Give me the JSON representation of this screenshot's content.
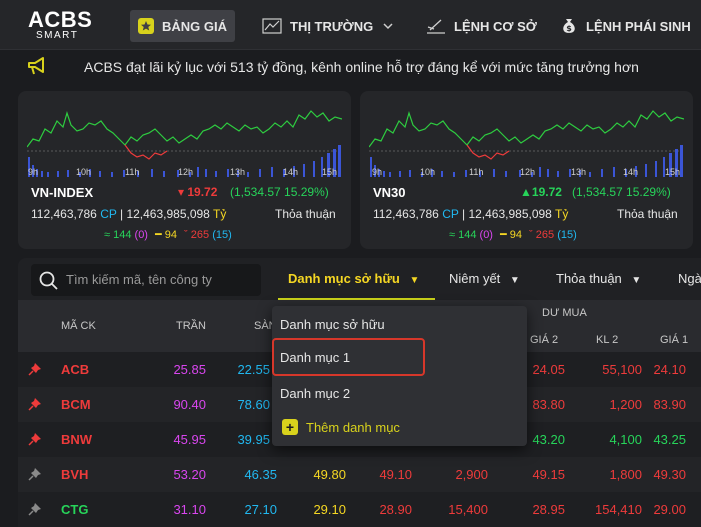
{
  "header": {
    "logo_main": "ACBS",
    "logo_sub": "SMART",
    "nav": [
      {
        "label": "BẢNG GIÁ",
        "icon": "star-icon",
        "active": true
      },
      {
        "label": "THỊ TRƯỜNG",
        "icon": "chart-icon"
      },
      {
        "label": "LỆNH CƠ SỞ",
        "icon": "pen-icon"
      },
      {
        "label": "LỆNH PHÁI SINH",
        "icon": "moneybag-icon"
      }
    ]
  },
  "ticker": {
    "text": "ACBS đạt lãi kỷ lục với 513 tỷ đồng, kênh online hỗ trợ đáng kể với mức tăng trưởng hơn"
  },
  "indices": [
    {
      "name": "VN-INDEX",
      "change": "19.72",
      "change_detail": "(1,534.57 15.29%)",
      "direction": "down",
      "volume": "112,463,786",
      "vol_unit": "CP",
      "value": "12,463,985,098",
      "val_unit": "Tỷ",
      "deal_label": "Thỏa thuận",
      "adv": "144",
      "adv_ceil": "(0)",
      "ref": "94",
      "dec": "265",
      "dec_floor": "(15)",
      "ticks": [
        "9h",
        "10h",
        "11h",
        "12h",
        "13h",
        "14h",
        "15h"
      ]
    },
    {
      "name": "VN30",
      "change": "19.72",
      "change_detail": "(1,534.57 15.29%)",
      "direction": "up",
      "volume": "112,463,786",
      "vol_unit": "CP",
      "value": "12,463,985,098",
      "val_unit": "Tỷ",
      "deal_label": "Thỏa thuận",
      "adv": "144",
      "adv_ceil": "(0)",
      "ref": "94",
      "dec": "265",
      "dec_floor": "(15)",
      "ticks": [
        "9h",
        "10h",
        "11h",
        "12h",
        "13h",
        "14h",
        "15h"
      ]
    }
  ],
  "search": {
    "placeholder": "Tìm kiếm mã, tên công ty"
  },
  "tabs": [
    "Danh mục sở hữu",
    "Niêm yết",
    "Thỏa thuận",
    "Ngà"
  ],
  "table": {
    "group_header": "DƯ MUA",
    "columns": [
      "MÃ CK",
      "TRẦN",
      "SÀN",
      "GIÁ 2",
      "KL 2",
      "GIÁ 1"
    ],
    "rows": [
      {
        "symbol": "ACB",
        "ceil": "25.85",
        "floor": "22.55",
        "buy_price2": "24.05",
        "buy_vol2": "55,100",
        "buy_price1": "24.10",
        "pinned": true
      },
      {
        "symbol": "BCM",
        "ceil": "90.40",
        "floor": "78.60",
        "buy_price2": "83.80",
        "buy_vol2": "1,200",
        "buy_price1": "83.90",
        "pinned": true
      },
      {
        "symbol": "BNW",
        "ceil": "45.95",
        "floor": "39.95",
        "buy_price2": "43.20",
        "buy_vol2": "4,100",
        "buy_price1": "43.25",
        "pinned": true
      },
      {
        "symbol": "BVH",
        "ceil": "53.20",
        "floor": "46.35",
        "ref": "49.80",
        "p3": "49.10",
        "v3": "2,900",
        "buy_price2": "49.15",
        "buy_vol2": "1,800",
        "buy_price1": "49.30",
        "pinned": false
      },
      {
        "symbol": "CTG",
        "ceil": "31.10",
        "floor": "27.10",
        "ref": "29.10",
        "p3": "28.90",
        "v3": "15,400",
        "buy_price2": "28.95",
        "buy_vol2": "154,410",
        "buy_price1": "29.00",
        "pinned": false
      }
    ]
  },
  "dropdown": {
    "header": "Danh mục sở hữu",
    "items": [
      "Danh mục 1",
      "Danh mục 2"
    ],
    "selected": "Danh mục 1",
    "add_label": "Thêm danh mục"
  },
  "colors": {
    "accent": "#f5d723",
    "up": "#27d45a",
    "down": "#ee3b3b",
    "ceil": "#d946ef",
    "floor": "#21b8f0",
    "ref": "#f5d723"
  }
}
